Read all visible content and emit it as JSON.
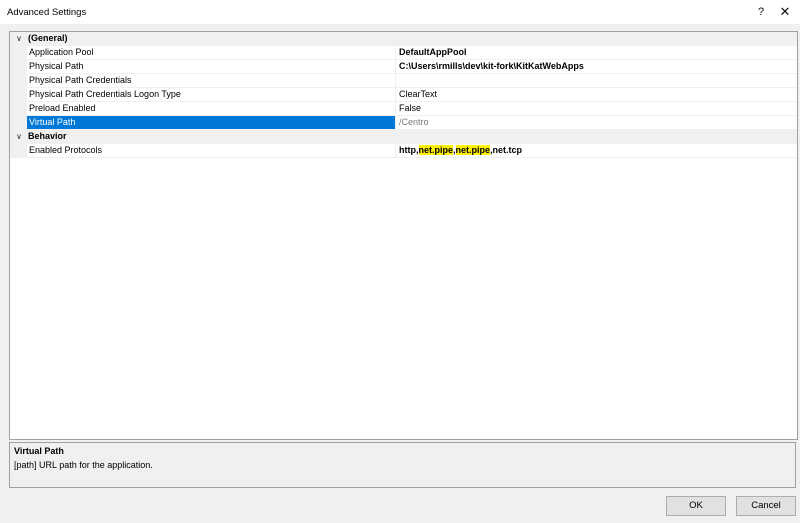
{
  "window": {
    "title": "Advanced Settings",
    "help_glyph": "?",
    "close_glyph": "✕"
  },
  "grid": {
    "collapse_glyph": "∨",
    "categories": [
      {
        "label": "(General)",
        "properties": [
          {
            "name": "Application Pool",
            "value": "DefaultAppPool"
          },
          {
            "name": "Physical Path",
            "value": "C:\\Users\\rmills\\dev\\kit-fork\\KitKatWebApps"
          },
          {
            "name": "Physical Path Credentials",
            "value": ""
          },
          {
            "name": "Physical Path Credentials Logon Type",
            "value": "ClearText"
          },
          {
            "name": "Preload Enabled",
            "value": "False"
          },
          {
            "name": "Virtual Path",
            "value": "/Centro",
            "selected": true
          }
        ]
      },
      {
        "label": "Behavior",
        "properties": [
          {
            "name": "Enabled Protocols",
            "value_parts": [
              "http,",
              "net.pipe",
              ",",
              "net.pipe",
              ",net.tcp"
            ]
          }
        ]
      }
    ]
  },
  "description": {
    "title": "Virtual Path",
    "text": "[path] URL path for the application."
  },
  "buttons": {
    "ok": "OK",
    "cancel": "Cancel"
  }
}
